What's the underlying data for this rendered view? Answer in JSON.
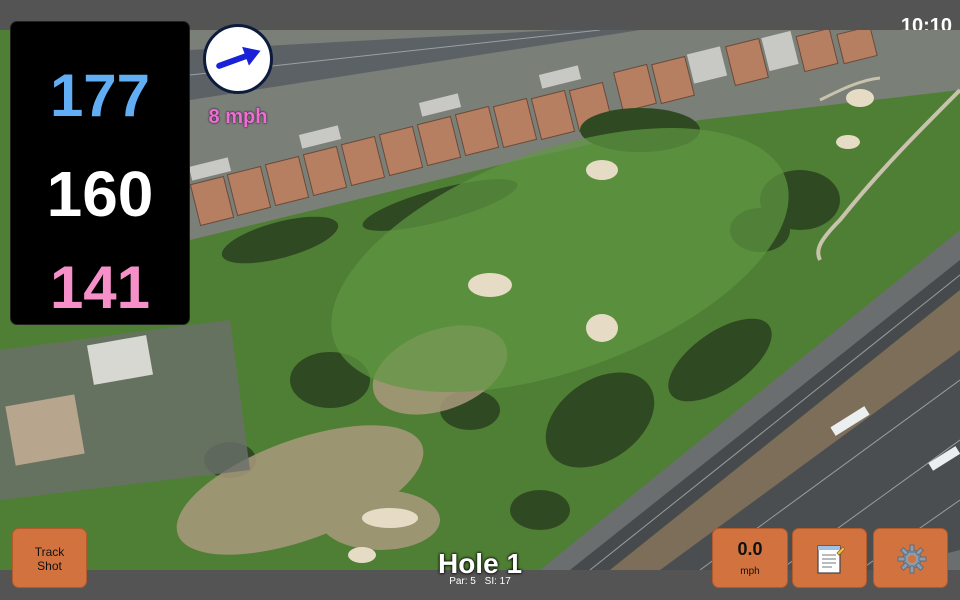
{
  "status_bar": {
    "time": "10:10"
  },
  "distances": {
    "back": "177",
    "middle": "160",
    "front": "141"
  },
  "wind": {
    "speed_label": "8 mph",
    "direction_icon": "arrow-icon"
  },
  "hole": {
    "title": "Hole 1",
    "par": "Par: 5",
    "stroke_index": "SI: 17"
  },
  "buttons": {
    "track_shot_line1": "Track",
    "track_shot_line2": "Shot",
    "speed_value": "0.0",
    "speed_unit": "mph",
    "notes_icon": "notepad-icon",
    "settings_icon": "gear-icon"
  },
  "colors": {
    "back_distance": "#62aef5",
    "middle_distance": "#ffffff",
    "front_distance": "#f590c8",
    "wind_speed": "#f06ad8",
    "button": "#d2733f"
  }
}
